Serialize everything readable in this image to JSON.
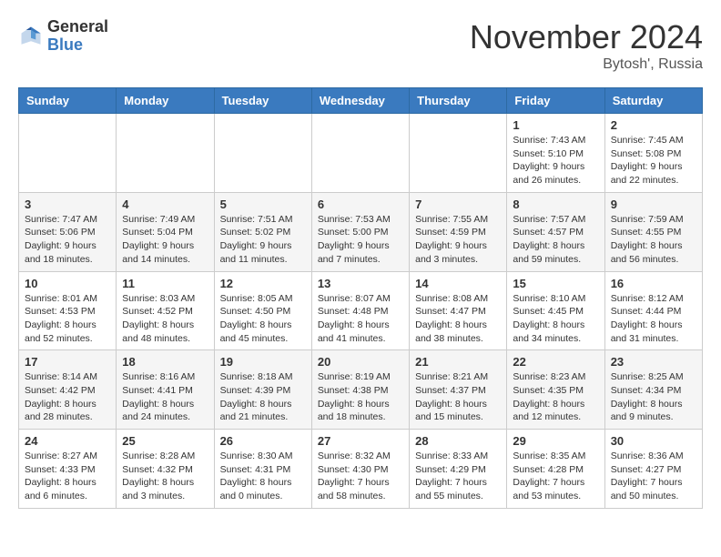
{
  "logo": {
    "general": "General",
    "blue": "Blue"
  },
  "title": "November 2024",
  "subtitle": "Bytosh', Russia",
  "days_of_week": [
    "Sunday",
    "Monday",
    "Tuesday",
    "Wednesday",
    "Thursday",
    "Friday",
    "Saturday"
  ],
  "weeks": [
    [
      {
        "day": "",
        "info": ""
      },
      {
        "day": "",
        "info": ""
      },
      {
        "day": "",
        "info": ""
      },
      {
        "day": "",
        "info": ""
      },
      {
        "day": "",
        "info": ""
      },
      {
        "day": "1",
        "info": "Sunrise: 7:43 AM\nSunset: 5:10 PM\nDaylight: 9 hours and 26 minutes."
      },
      {
        "day": "2",
        "info": "Sunrise: 7:45 AM\nSunset: 5:08 PM\nDaylight: 9 hours and 22 minutes."
      }
    ],
    [
      {
        "day": "3",
        "info": "Sunrise: 7:47 AM\nSunset: 5:06 PM\nDaylight: 9 hours and 18 minutes."
      },
      {
        "day": "4",
        "info": "Sunrise: 7:49 AM\nSunset: 5:04 PM\nDaylight: 9 hours and 14 minutes."
      },
      {
        "day": "5",
        "info": "Sunrise: 7:51 AM\nSunset: 5:02 PM\nDaylight: 9 hours and 11 minutes."
      },
      {
        "day": "6",
        "info": "Sunrise: 7:53 AM\nSunset: 5:00 PM\nDaylight: 9 hours and 7 minutes."
      },
      {
        "day": "7",
        "info": "Sunrise: 7:55 AM\nSunset: 4:59 PM\nDaylight: 9 hours and 3 minutes."
      },
      {
        "day": "8",
        "info": "Sunrise: 7:57 AM\nSunset: 4:57 PM\nDaylight: 8 hours and 59 minutes."
      },
      {
        "day": "9",
        "info": "Sunrise: 7:59 AM\nSunset: 4:55 PM\nDaylight: 8 hours and 56 minutes."
      }
    ],
    [
      {
        "day": "10",
        "info": "Sunrise: 8:01 AM\nSunset: 4:53 PM\nDaylight: 8 hours and 52 minutes."
      },
      {
        "day": "11",
        "info": "Sunrise: 8:03 AM\nSunset: 4:52 PM\nDaylight: 8 hours and 48 minutes."
      },
      {
        "day": "12",
        "info": "Sunrise: 8:05 AM\nSunset: 4:50 PM\nDaylight: 8 hours and 45 minutes."
      },
      {
        "day": "13",
        "info": "Sunrise: 8:07 AM\nSunset: 4:48 PM\nDaylight: 8 hours and 41 minutes."
      },
      {
        "day": "14",
        "info": "Sunrise: 8:08 AM\nSunset: 4:47 PM\nDaylight: 8 hours and 38 minutes."
      },
      {
        "day": "15",
        "info": "Sunrise: 8:10 AM\nSunset: 4:45 PM\nDaylight: 8 hours and 34 minutes."
      },
      {
        "day": "16",
        "info": "Sunrise: 8:12 AM\nSunset: 4:44 PM\nDaylight: 8 hours and 31 minutes."
      }
    ],
    [
      {
        "day": "17",
        "info": "Sunrise: 8:14 AM\nSunset: 4:42 PM\nDaylight: 8 hours and 28 minutes."
      },
      {
        "day": "18",
        "info": "Sunrise: 8:16 AM\nSunset: 4:41 PM\nDaylight: 8 hours and 24 minutes."
      },
      {
        "day": "19",
        "info": "Sunrise: 8:18 AM\nSunset: 4:39 PM\nDaylight: 8 hours and 21 minutes."
      },
      {
        "day": "20",
        "info": "Sunrise: 8:19 AM\nSunset: 4:38 PM\nDaylight: 8 hours and 18 minutes."
      },
      {
        "day": "21",
        "info": "Sunrise: 8:21 AM\nSunset: 4:37 PM\nDaylight: 8 hours and 15 minutes."
      },
      {
        "day": "22",
        "info": "Sunrise: 8:23 AM\nSunset: 4:35 PM\nDaylight: 8 hours and 12 minutes."
      },
      {
        "day": "23",
        "info": "Sunrise: 8:25 AM\nSunset: 4:34 PM\nDaylight: 8 hours and 9 minutes."
      }
    ],
    [
      {
        "day": "24",
        "info": "Sunrise: 8:27 AM\nSunset: 4:33 PM\nDaylight: 8 hours and 6 minutes."
      },
      {
        "day": "25",
        "info": "Sunrise: 8:28 AM\nSunset: 4:32 PM\nDaylight: 8 hours and 3 minutes."
      },
      {
        "day": "26",
        "info": "Sunrise: 8:30 AM\nSunset: 4:31 PM\nDaylight: 8 hours and 0 minutes."
      },
      {
        "day": "27",
        "info": "Sunrise: 8:32 AM\nSunset: 4:30 PM\nDaylight: 7 hours and 58 minutes."
      },
      {
        "day": "28",
        "info": "Sunrise: 8:33 AM\nSunset: 4:29 PM\nDaylight: 7 hours and 55 minutes."
      },
      {
        "day": "29",
        "info": "Sunrise: 8:35 AM\nSunset: 4:28 PM\nDaylight: 7 hours and 53 minutes."
      },
      {
        "day": "30",
        "info": "Sunrise: 8:36 AM\nSunset: 4:27 PM\nDaylight: 7 hours and 50 minutes."
      }
    ]
  ]
}
